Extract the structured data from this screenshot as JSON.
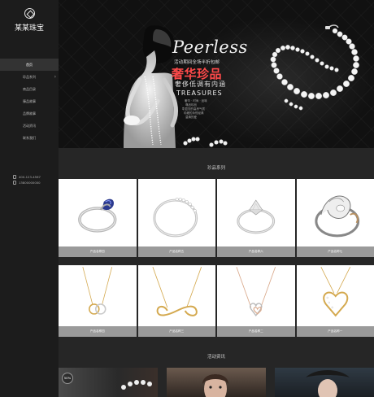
{
  "site": {
    "logo_text": "某某珠宝"
  },
  "nav": {
    "items": [
      {
        "label": "首页",
        "active": true
      },
      {
        "label": "珍品系列",
        "has_sub": true
      },
      {
        "label": "商品目录"
      },
      {
        "label": "臻品故事"
      },
      {
        "label": "品牌故事"
      },
      {
        "label": "活动资讯"
      },
      {
        "label": "联系我们"
      }
    ]
  },
  "contact": {
    "phone": "400-123-4567",
    "mobile": "13800000000"
  },
  "banner": {
    "title": "Peerless",
    "promo": "活动期间全场半折包邮",
    "headline_cn": "奢华珍品",
    "sub_cn": "奢侈低调有内涵",
    "headline_en": "TREASURES",
    "lines": [
      "奢华 · 时尚 · 品味",
      "尊品珍品",
      "彰显您的高贵气质",
      "珍藏的永恒经典",
      "温情的爱"
    ]
  },
  "products_section": {
    "title": "珍品系列",
    "row1": [
      {
        "caption": "产品名称四"
      },
      {
        "caption": "产品名称五"
      },
      {
        "caption": "产品名称六"
      },
      {
        "caption": "产品名称七"
      }
    ],
    "row2": [
      {
        "caption": "产品名称四"
      },
      {
        "caption": "产品名称三"
      },
      {
        "caption": "产品名称二"
      },
      {
        "caption": "产品名称一"
      }
    ]
  },
  "news_section": {
    "title": "活动资讯",
    "items": [
      {
        "badge": "50%"
      },
      {
        "badge": ""
      },
      {
        "badge": ""
      }
    ]
  },
  "colors": {
    "sidebar_bg": "#1c1c1c",
    "main_bg": "#262626",
    "accent_red": "#ff4a4a",
    "caption_gray": "#9a9a9a"
  }
}
